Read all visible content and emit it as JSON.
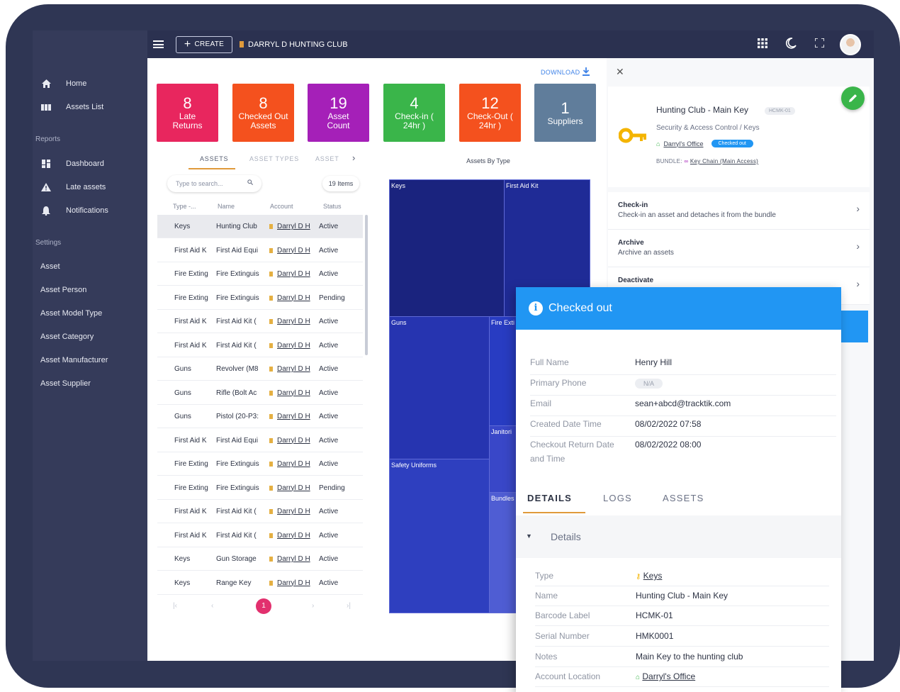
{
  "topbar": {
    "create_label": "CREATE",
    "club_name": "DARRYL D HUNTING CLUB"
  },
  "sidebar": {
    "home": "Home",
    "assets_list": "Assets List",
    "reports_section": "Reports",
    "dashboard": "Dashboard",
    "late_assets": "Late assets",
    "notifications": "Notifications",
    "settings_section": "Settings",
    "settings_items": [
      "Asset",
      "Asset Person",
      "Asset Model Type",
      "Asset Category",
      "Asset Manufacturer",
      "Asset Supplier"
    ]
  },
  "download_label": "DOWNLOAD",
  "stats": [
    {
      "num": "8",
      "label": "Late Returns",
      "color": "#e8265e"
    },
    {
      "num": "8",
      "label": "Checked Out Assets",
      "color": "#f4511e"
    },
    {
      "num": "19",
      "label": "Asset Count",
      "color": "#a520b8"
    },
    {
      "num": "4",
      "label": "Check-in ( 24hr )",
      "color": "#3ab54a"
    },
    {
      "num": "12",
      "label": "Check-Out ( 24hr )",
      "color": "#f4511e"
    },
    {
      "num": "1",
      "label": "Suppliers",
      "color": "#607d9b"
    }
  ],
  "tabs": {
    "assets": "ASSETS",
    "asset_types": "ASSET TYPES",
    "asset": "ASSET"
  },
  "search_placeholder": "Type to search...",
  "items_count": "19 Items",
  "table": {
    "headers": [
      "Type -...",
      "Name",
      "Account",
      "Status"
    ],
    "rows": [
      [
        "Keys",
        "Hunting Club",
        "Darryl D H",
        "Active"
      ],
      [
        "First Aid K",
        "First Aid Equi",
        "Darryl D H",
        "Active"
      ],
      [
        "Fire Exting",
        "Fire Extinguis",
        "Darryl D H",
        "Active"
      ],
      [
        "Fire Exting",
        "Fire Extinguis",
        "Darryl D H",
        "Pending"
      ],
      [
        "First Aid K",
        "First Aid Kit (",
        "Darryl D H",
        "Active"
      ],
      [
        "First Aid K",
        "First Aid Kit (",
        "Darryl D H",
        "Active"
      ],
      [
        "Guns",
        "Revolver (M8",
        "Darryl D H",
        "Active"
      ],
      [
        "Guns",
        "Rifle (Bolt Ac",
        "Darryl D H",
        "Active"
      ],
      [
        "Guns",
        "Pistol (20-P3:",
        "Darryl D H",
        "Active"
      ],
      [
        "First Aid K",
        "First Aid Equi",
        "Darryl D H",
        "Active"
      ],
      [
        "Fire Exting",
        "Fire Extinguis",
        "Darryl D H",
        "Active"
      ],
      [
        "Fire Exting",
        "Fire Extinguis",
        "Darryl D H",
        "Pending"
      ],
      [
        "First Aid K",
        "First Aid Kit (",
        "Darryl D H",
        "Active"
      ],
      [
        "First Aid K",
        "First Aid Kit (",
        "Darryl D H",
        "Active"
      ],
      [
        "Keys",
        "Gun Storage",
        "Darryl D H",
        "Active"
      ],
      [
        "Keys",
        "Range Key",
        "Darryl D H",
        "Active"
      ]
    ]
  },
  "pager": {
    "first": "|‹",
    "prev": "‹",
    "current": "1",
    "next": "›",
    "last": "›|"
  },
  "treemap": {
    "title": "Assets By Type",
    "labels": {
      "keys": "Keys",
      "first_aid": "First Aid Kit",
      "guns": "Guns",
      "fire": "Fire Exti",
      "janitorial": "Janitori",
      "safety": "Safety Uniforms",
      "bundles": "Bundles"
    }
  },
  "detail": {
    "title": "Hunting Club - Main Key",
    "code": "HCMK-01",
    "category": "Security & Access Control / Keys",
    "location": "Darryl's Office",
    "status_pill": "Checked out",
    "bundle_label": "BUNDLE:",
    "bundle_value": "Key Chain (Main Access)"
  },
  "actions": [
    {
      "title": "Check-in",
      "desc": "Check-in an asset and detaches it from the bundle"
    },
    {
      "title": "Archive",
      "desc": "Archive an assets"
    },
    {
      "title": "Deactivate",
      "desc": ""
    }
  ],
  "popup": {
    "header": "Checked out",
    "fields": [
      {
        "label": "Full Name",
        "value": "Henry Hill"
      },
      {
        "label": "Primary Phone",
        "value": "N/A"
      },
      {
        "label": "Email",
        "value": "sean+abcd@tracktik.com"
      },
      {
        "label": "Created Date Time",
        "value": "08/02/2022 07:58"
      },
      {
        "label": "Checkout Return Date and Time",
        "value": "08/02/2022 08:00"
      }
    ],
    "tabs": [
      "DETAILS",
      "LOGS",
      "ASSETS"
    ],
    "section": "Details",
    "details": [
      {
        "label": "Type",
        "value": "Keys"
      },
      {
        "label": "Name",
        "value": "Hunting Club - Main Key"
      },
      {
        "label": "Barcode Label",
        "value": "HCMK-01"
      },
      {
        "label": "Serial Number",
        "value": "HMK0001"
      },
      {
        "label": "Notes",
        "value": "Main Key to the hunting club"
      },
      {
        "label": "Account Location",
        "value": "Darryl's Office"
      }
    ]
  }
}
